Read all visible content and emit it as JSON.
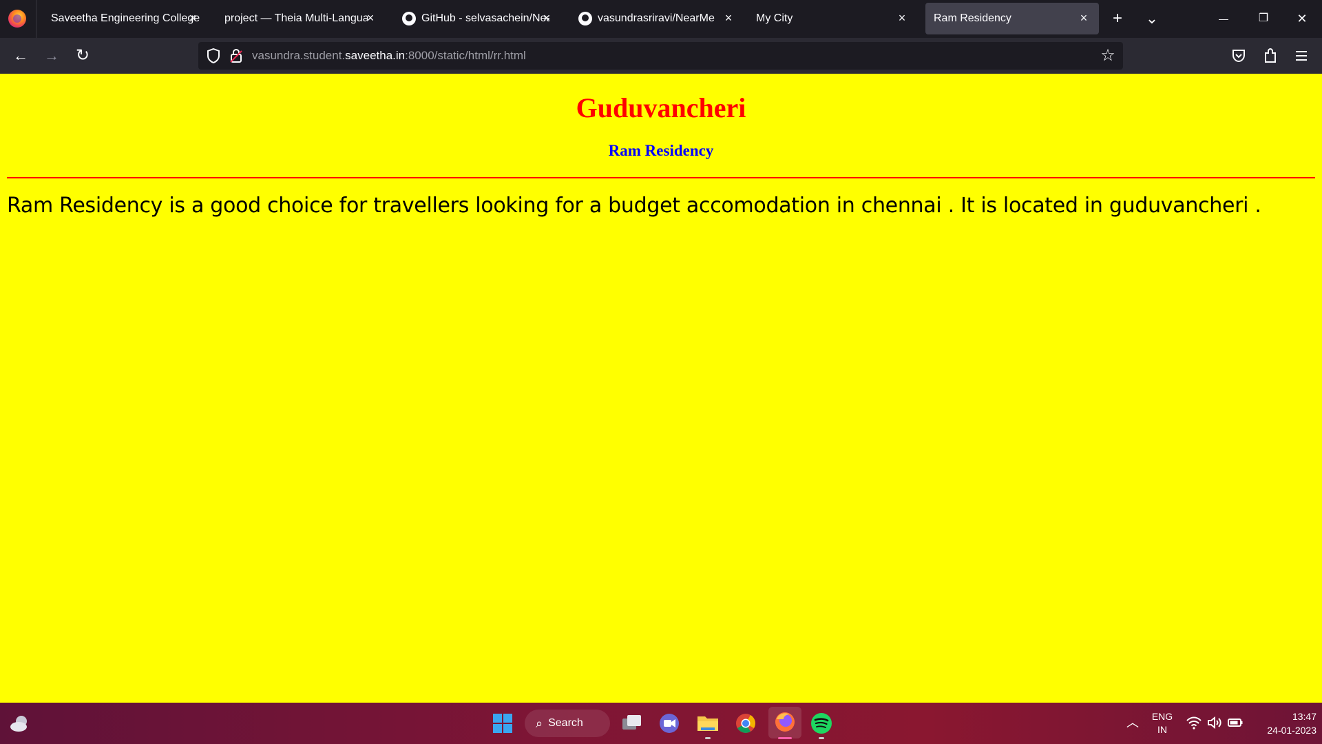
{
  "browser": {
    "tabs": [
      {
        "label": "Saveetha Engineering College",
        "icon": "none",
        "active": false
      },
      {
        "label": "project — Theia Multi-Language",
        "icon": "none",
        "active": false
      },
      {
        "label": "GitHub - selvasachein/NearMe",
        "icon": "github-icon",
        "active": false
      },
      {
        "label": "vasundrasriravi/NearMe",
        "icon": "github-icon",
        "active": false
      },
      {
        "label": "My City",
        "icon": "none",
        "active": false
      },
      {
        "label": "Ram Residency",
        "icon": "none",
        "active": true
      }
    ],
    "close_glyph": "×",
    "new_tab_glyph": "+",
    "list_tabs_glyph": "⌄",
    "window": {
      "minimize": "—",
      "restore": "❐",
      "close": "✕"
    },
    "nav": {
      "back": "←",
      "forward": "→",
      "reload": "↻"
    },
    "url": {
      "prefix": "vasundra.student.",
      "host": "saveetha.in",
      "rest": ":8000/static/html/rr.html"
    },
    "star": "☆"
  },
  "page": {
    "background": "#ffff00",
    "heading": "Guduvancheri",
    "heading_color": "#ff0000",
    "subheading": "Ram Residency",
    "subheading_color": "#0000ff",
    "rule_color": "#ff0000",
    "paragraph": "Ram Residency is a good choice for travellers looking for a budget accomodation in chennai . It is located in guduvancheri ."
  },
  "taskbar": {
    "search_label": "Search",
    "apps": [
      "windows-start-icon",
      "task-view-icon",
      "teams-chat-icon",
      "file-explorer-icon",
      "chrome-icon",
      "firefox-icon",
      "spotify-icon"
    ],
    "language": {
      "line1": "ENG",
      "line2": "IN"
    },
    "time": "13:47",
    "date": "24-01-2023"
  }
}
